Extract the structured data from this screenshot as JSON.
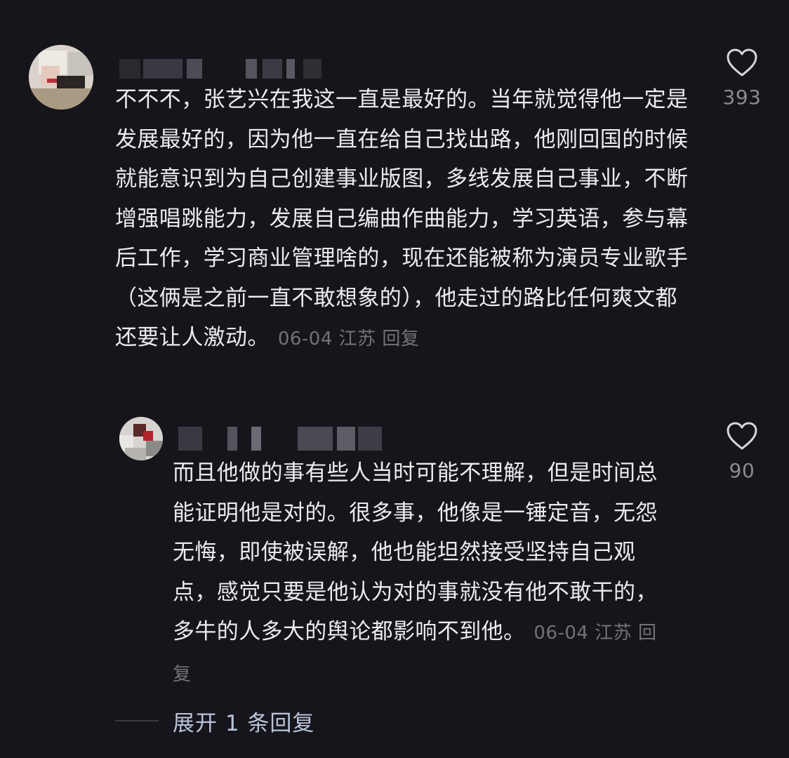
{
  "comments": [
    {
      "text": "不不不，张艺兴在我这一直是最好的。当年就觉得他一定是发展最好的，因为他一直在给自己找出路，他刚回国的时候就能意识到为自己创建事业版图，多线发展自己事业，不断增强唱跳能力，发展自己编曲作曲能力，学习英语，参与幕后工作，学习商业管理啥的，现在还能被称为演员专业歌手（这俩是之前一直不敢想象的），他走过的路比任何爽文都还要让人激动。",
      "date": "06-04",
      "location": "江苏",
      "reply_label": "回复",
      "likes": "393",
      "like_icon": "heart-outline-icon"
    },
    {
      "text": "而且他做的事有些人当时可能不理解，但是时间总能证明他是对的。很多事，他像是一锤定音，无怨无悔，即使被误解，他也能坦然接受坚持自己观点，感觉只要是他认为对的事就没有他不敢干的，多牛的人多大的舆论都影响不到他。",
      "date": "06-04",
      "location": "江苏",
      "reply_label": "回复",
      "likes": "90",
      "like_icon": "heart-outline-icon"
    }
  ],
  "expand_replies": {
    "label": "展开 1 条回复"
  },
  "colors": {
    "background": "#16151b",
    "text": "#ecebef",
    "meta": "#737279",
    "expand_link": "#b9c4d9"
  }
}
